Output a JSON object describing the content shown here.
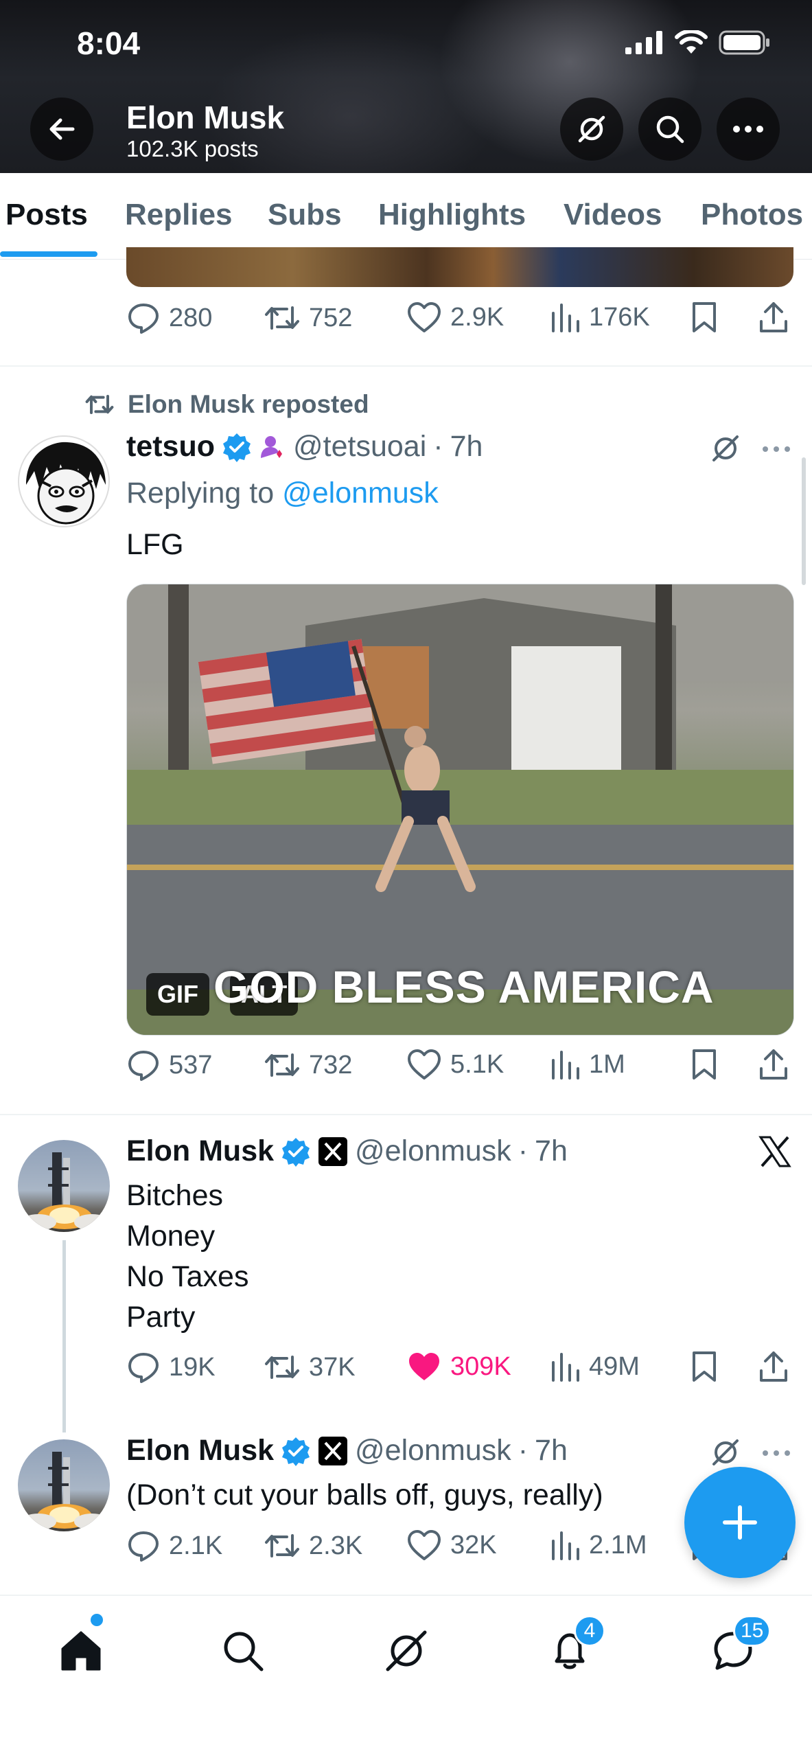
{
  "status_bar": {
    "time": "8:04"
  },
  "header": {
    "title": "Elon Musk",
    "subtitle": "102.3K posts"
  },
  "tabs": [
    {
      "label": "Posts",
      "active": true
    },
    {
      "label": "Replies"
    },
    {
      "label": "Subs"
    },
    {
      "label": "Highlights"
    },
    {
      "label": "Videos"
    },
    {
      "label": "Photos"
    }
  ],
  "posts": [
    {
      "actions": {
        "replies": "280",
        "reposts": "752",
        "likes": "2.9K",
        "views": "176K"
      }
    },
    {
      "repost_label": "Elon Musk reposted",
      "name": "tetsuo",
      "handle": "@tetsuoai",
      "time": "7h",
      "replying_prefix": "Replying to ",
      "replying_to": "@elonmusk",
      "text": "LFG",
      "media": {
        "caption": "GOD BLESS AMERICA",
        "badges": [
          "GIF",
          "ALT"
        ]
      },
      "actions": {
        "replies": "537",
        "reposts": "732",
        "likes": "5.1K",
        "views": "1M"
      }
    },
    {
      "name": "Elon Musk",
      "handle": "@elonmusk",
      "time": "7h",
      "text": "Bitches\nMoney\nNo Taxes\nParty",
      "actions": {
        "replies": "19K",
        "reposts": "37K",
        "likes": "309K",
        "views": "49M",
        "liked": true
      }
    },
    {
      "name": "Elon Musk",
      "handle": "@elonmusk",
      "time": "7h",
      "text": "(Don’t cut your balls off, guys, really)",
      "actions": {
        "replies": "2.1K",
        "reposts": "2.3K",
        "likes": "32K",
        "views": "2.1M"
      }
    }
  ],
  "bottom_nav": {
    "items": [
      "home-icon",
      "search-icon",
      "grok-icon",
      "notifications-icon",
      "messages-icon"
    ],
    "notifications_badge": "4",
    "messages_badge": "15"
  },
  "colors": {
    "accent": "#1d9bf0",
    "like": "#f91880",
    "secondary_text": "#536471",
    "verified": "#1d9bf0"
  }
}
